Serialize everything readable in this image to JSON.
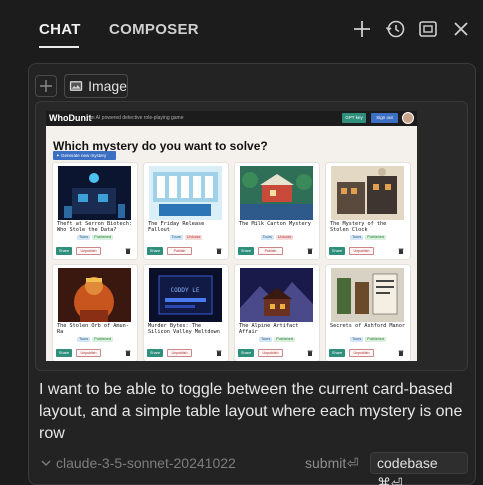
{
  "header": {
    "tabs": [
      {
        "label": "CHAT"
      },
      {
        "label": "COMPOSER"
      }
    ],
    "icons": [
      "plus-icon",
      "history-icon",
      "maximize-icon",
      "close-icon"
    ]
  },
  "attach": {
    "image_label": "Image"
  },
  "screenshot": {
    "app_title": "WhoDunit",
    "app_tagline": "an AI powered detective role-playing game",
    "gpt_key_label": "GPT key",
    "signout_label": "Sign out",
    "heading": "Which mystery do you want to solve?",
    "generate_label": "✦ Generate new mystery",
    "share_label": "Share",
    "unpublish_label": "Unpublish",
    "publish_label": "Publish",
    "cards": [
      {
        "title": "Theft at Serron Biotech: Who Stole the Data?",
        "tours": "Tours",
        "status": "Published",
        "action": "Unpublish"
      },
      {
        "title": "The Friday Release Fallout",
        "tours": "Tours",
        "status": "Unlocks",
        "action": "Publish"
      },
      {
        "title": "The Milk Carton Mystery",
        "tours": "Tours",
        "status": "Unlocks",
        "action": "Publish"
      },
      {
        "title": "The Mystery of the Stolen Clock",
        "tours": "Tours",
        "status": "Published",
        "action": "Unpublish"
      },
      {
        "title": "The Stolen Orb of Amun-Ra",
        "tours": "Tours",
        "status": "Published",
        "action": "Unpublish"
      },
      {
        "title": "Murder Bytes: The Silicon Valley Meltdown",
        "tours": "",
        "status": "",
        "action": "Unpublish"
      },
      {
        "title": "The Alpine Artifact Affair",
        "tours": "Tours",
        "status": "Published",
        "action": "Unpublish"
      },
      {
        "title": "Secrets of Ashford Manor",
        "tours": "Tours",
        "status": "Published",
        "action": "Unpublish"
      }
    ],
    "neon_sign": "CODDY LE"
  },
  "message": {
    "text": "I want to be able to toggle between the current card-based layout, and a simple table layout where each mystery is one row"
  },
  "footer": {
    "model": "claude-3-5-sonnet-20241022",
    "submit_label": "submit",
    "submit_shortcut": "⏎",
    "codebase_label": "codebase ⌘⏎"
  },
  "colors": {
    "background": "#1c1c1c",
    "panel": "#232323",
    "accent_teal": "#2f8f7d",
    "accent_blue": "#3b6fc4"
  }
}
